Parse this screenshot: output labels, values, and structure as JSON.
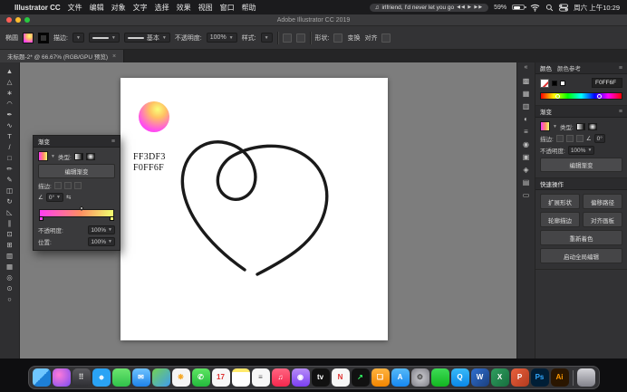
{
  "menu_bar": {
    "apple_icon": "",
    "app_name": "Illustrator CC",
    "items": [
      "文件",
      "编辑",
      "对象",
      "文字",
      "选择",
      "效果",
      "视图",
      "窗口",
      "帮助"
    ],
    "music": {
      "icon": "♫",
      "title": "irlfriend, I'd never let you go",
      "controls": "◀◀ ▶ ▶▶"
    },
    "battery_percent": "59%",
    "clock": "周六 上午10:29"
  },
  "title_bar": {
    "title": "Adobe Illustrator CC 2019"
  },
  "control_bar": {
    "selection_label": "椭圆",
    "stroke_label": "描边:",
    "profile_value": "",
    "brush_value": "基本",
    "opacity_label": "不透明度:",
    "opacity_value": "100%",
    "style_label": "样式:",
    "shape_label": "形状:",
    "transform_label": "变换",
    "align_label": "对齐"
  },
  "document_tab": {
    "title": "未标题-2* @ 66.67% (RGB/GPU 预览)",
    "close": "×"
  },
  "tools": [
    {
      "name": "selection-tool",
      "glyph": "▲"
    },
    {
      "name": "direct-selection-tool",
      "glyph": "△"
    },
    {
      "name": "magic-wand-tool",
      "glyph": "∗"
    },
    {
      "name": "lasso-tool",
      "glyph": "◠"
    },
    {
      "name": "pen-tool",
      "glyph": "✒"
    },
    {
      "name": "curvature-tool",
      "glyph": "∿"
    },
    {
      "name": "type-tool",
      "glyph": "T"
    },
    {
      "name": "line-segment-tool",
      "glyph": "/"
    },
    {
      "name": "rectangle-tool",
      "glyph": "□"
    },
    {
      "name": "paintbrush-tool",
      "glyph": "✏"
    },
    {
      "name": "pencil-tool",
      "glyph": "✎"
    },
    {
      "name": "eraser-tool",
      "glyph": "◫"
    },
    {
      "name": "rotate-tool",
      "glyph": "↻"
    },
    {
      "name": "scale-tool",
      "glyph": "◺"
    },
    {
      "name": "width-tool",
      "glyph": "∥"
    },
    {
      "name": "free-transform-tool",
      "glyph": "⊡"
    },
    {
      "name": "shape-builder-tool",
      "glyph": "⊞"
    },
    {
      "name": "gradient-tool",
      "glyph": "▥"
    },
    {
      "name": "mesh-tool",
      "glyph": "▦"
    },
    {
      "name": "eyedropper-tool",
      "glyph": "◎"
    },
    {
      "name": "blend-tool",
      "glyph": "⊙"
    },
    {
      "name": "zoom-tool",
      "glyph": "○"
    }
  ],
  "gradient_panel": {
    "tab": "渐变",
    "menu_icon": "≡",
    "type_label": "类型:",
    "edit_button": "编辑渐变",
    "stroke_label": "描边:",
    "angle_icon": "∠",
    "angle_value": "0°",
    "reverse_icon": "⇆",
    "opacity_label": "不透明度:",
    "opacity_value": "100%",
    "location_label": "位置:",
    "location_value": "100%",
    "gradient_start": "#FF3DF3",
    "gradient_end": "#F0FF6F"
  },
  "artboard": {
    "hex_line1": "FF3DF3",
    "hex_line2": "F0FF6F",
    "heart_color": "#1a1a1a",
    "circle_gradient": {
      "start": "#FF3DF3",
      "end": "#F0FF6F"
    }
  },
  "panel_strip": {
    "expand_icon": "«",
    "icons": [
      {
        "name": "color-panel-icon",
        "glyph": "▩"
      },
      {
        "name": "swatches-panel-icon",
        "glyph": "▦"
      },
      {
        "name": "gradient-panel-icon",
        "glyph": "▥"
      },
      {
        "name": "transparency-panel-icon",
        "glyph": "◐"
      },
      {
        "name": "stroke-panel-icon",
        "glyph": "≡"
      },
      {
        "name": "appearance-panel-icon",
        "glyph": "◉"
      },
      {
        "name": "graphic-styles-panel-icon",
        "glyph": "▣"
      },
      {
        "name": "symbols-panel-icon",
        "glyph": "◈"
      },
      {
        "name": "layers-panel-icon",
        "glyph": "▤"
      },
      {
        "name": "artboards-panel-icon",
        "glyph": "▭"
      }
    ]
  },
  "right_panel": {
    "color_panel": {
      "tab_active": "颜色",
      "tab_inactive": "颜色参考",
      "menu_icon": "≡",
      "hex": "F0FF6F"
    },
    "gradient_section": {
      "tab": "渐变",
      "menu_icon": "≡",
      "type_label": "类型:",
      "stroke_label": "描边:",
      "angle_icon": "∠",
      "angle_value": "0°",
      "opacity_label": "不透明度:",
      "opacity_value": "100%",
      "edit_button": "编辑渐变"
    },
    "quick_actions": {
      "title": "快速操作",
      "small_buttons": [
        "扩展形状",
        "偏移路径",
        "轮廓描边",
        "对齐画板"
      ],
      "wide_buttons": [
        "重新着色",
        "启动全局编辑"
      ]
    }
  },
  "dock": [
    {
      "name": "dock-item-finder",
      "bg": "linear-gradient(135deg,#6fc6ff 50%,#1d7fd6 50%)",
      "glyph": "",
      "fg": "#fff"
    },
    {
      "name": "dock-item-siri",
      "bg": "radial-gradient(circle at 35% 35%,#ff7ad9,#7a4df0)",
      "glyph": "",
      "fg": "#fff"
    },
    {
      "name": "dock-item-launchpad",
      "bg": "linear-gradient(180deg,#5a5a5f,#2e2e33)",
      "glyph": "⠿",
      "fg": "#ddd"
    },
    {
      "name": "dock-item-safari",
      "bg": "radial-gradient(circle,#eaf6ff 0%,#eaf6ff 16%,#2aa3f5 18%)",
      "glyph": "",
      "fg": "#fff"
    },
    {
      "name": "dock-item-messages",
      "bg": "linear-gradient(180deg,#6be56f,#2fc14a)",
      "glyph": "",
      "fg": "#fff"
    },
    {
      "name": "dock-item-mail",
      "bg": "linear-gradient(180deg,#6ec2ff,#1e82e8)",
      "glyph": "✉",
      "fg": "#fff"
    },
    {
      "name": "dock-item-maps",
      "bg": "linear-gradient(135deg,#73d253,#3f9cf0)",
      "glyph": "",
      "fg": "#fff"
    },
    {
      "name": "dock-item-photos",
      "bg": "#f5f5f5",
      "glyph": "❋",
      "fg": "#f5a623"
    },
    {
      "name": "dock-item-facetime",
      "bg": "linear-gradient(180deg,#5ee563,#23b93c)",
      "glyph": "✆",
      "fg": "#fff"
    },
    {
      "name": "dock-item-calendar",
      "bg": "#f7f7f7",
      "glyph": "17",
      "fg": "#d33"
    },
    {
      "name": "dock-item-notes",
      "bg": "linear-gradient(180deg,#ffe96b 20%,#fff 20%)",
      "glyph": "",
      "fg": "#555"
    },
    {
      "name": "dock-item-reminders",
      "bg": "#f7f7f7",
      "glyph": "≡",
      "fg": "#555"
    },
    {
      "name": "dock-item-music",
      "bg": "linear-gradient(180deg,#ff6581,#f4274d)",
      "glyph": "♫",
      "fg": "#fff"
    },
    {
      "name": "dock-item-podcasts",
      "bg": "linear-gradient(180deg,#b68cf8,#7b3ff2)",
      "glyph": "◉",
      "fg": "#fff"
    },
    {
      "name": "dock-item-tv",
      "bg": "#111",
      "glyph": "tv",
      "fg": "#fff"
    },
    {
      "name": "dock-item-news",
      "bg": "#f7f7f7",
      "glyph": "N",
      "fg": "#e03131"
    },
    {
      "name": "dock-item-stocks",
      "bg": "#111",
      "glyph": "↗",
      "fg": "#3f6"
    },
    {
      "name": "dock-item-books",
      "bg": "linear-gradient(180deg,#ffb340,#f28500)",
      "glyph": "❏",
      "fg": "#fff"
    },
    {
      "name": "dock-item-app-store",
      "bg": "linear-gradient(180deg,#55b9f8,#1687f0)",
      "glyph": "A",
      "fg": "#fff"
    },
    {
      "name": "dock-item-system-preferences",
      "bg": "radial-gradient(circle,#cfcfd4,#7e7e86)",
      "glyph": "⚙",
      "fg": "#444"
    },
    {
      "name": "dock-item-wechat",
      "bg": "linear-gradient(180deg,#3ddc55,#12b521)",
      "glyph": "",
      "fg": "#fff"
    },
    {
      "name": "dock-item-qq",
      "bg": "linear-gradient(180deg,#38b9f8,#0a87e8)",
      "glyph": "Q",
      "fg": "#fff"
    },
    {
      "name": "dock-item-word",
      "bg": "linear-gradient(135deg,#2f6fd0,#1b3f7e)",
      "glyph": "W",
      "fg": "#fff"
    },
    {
      "name": "dock-item-excel",
      "bg": "linear-gradient(135deg,#2f9e5f,#176e3e)",
      "glyph": "X",
      "fg": "#fff"
    },
    {
      "name": "dock-item-powerpoint",
      "bg": "linear-gradient(135deg,#e8603c,#b33a1e)",
      "glyph": "P",
      "fg": "#fff"
    },
    {
      "name": "dock-item-photoshop",
      "bg": "#001e36",
      "glyph": "Ps",
      "fg": "#31a8ff"
    },
    {
      "name": "dock-item-illustrator",
      "bg": "#2a1600",
      "glyph": "Ai",
      "fg": "#ff9a00"
    },
    {
      "name": "dock-item-divider",
      "bg": "rgba(255,255,255,.25)",
      "glyph": "",
      "fg": "#fff"
    },
    {
      "name": "dock-item-trash",
      "bg": "linear-gradient(180deg,rgba(230,230,235,.9),rgba(150,150,160,.8))",
      "glyph": "",
      "fg": "#fff"
    }
  ]
}
